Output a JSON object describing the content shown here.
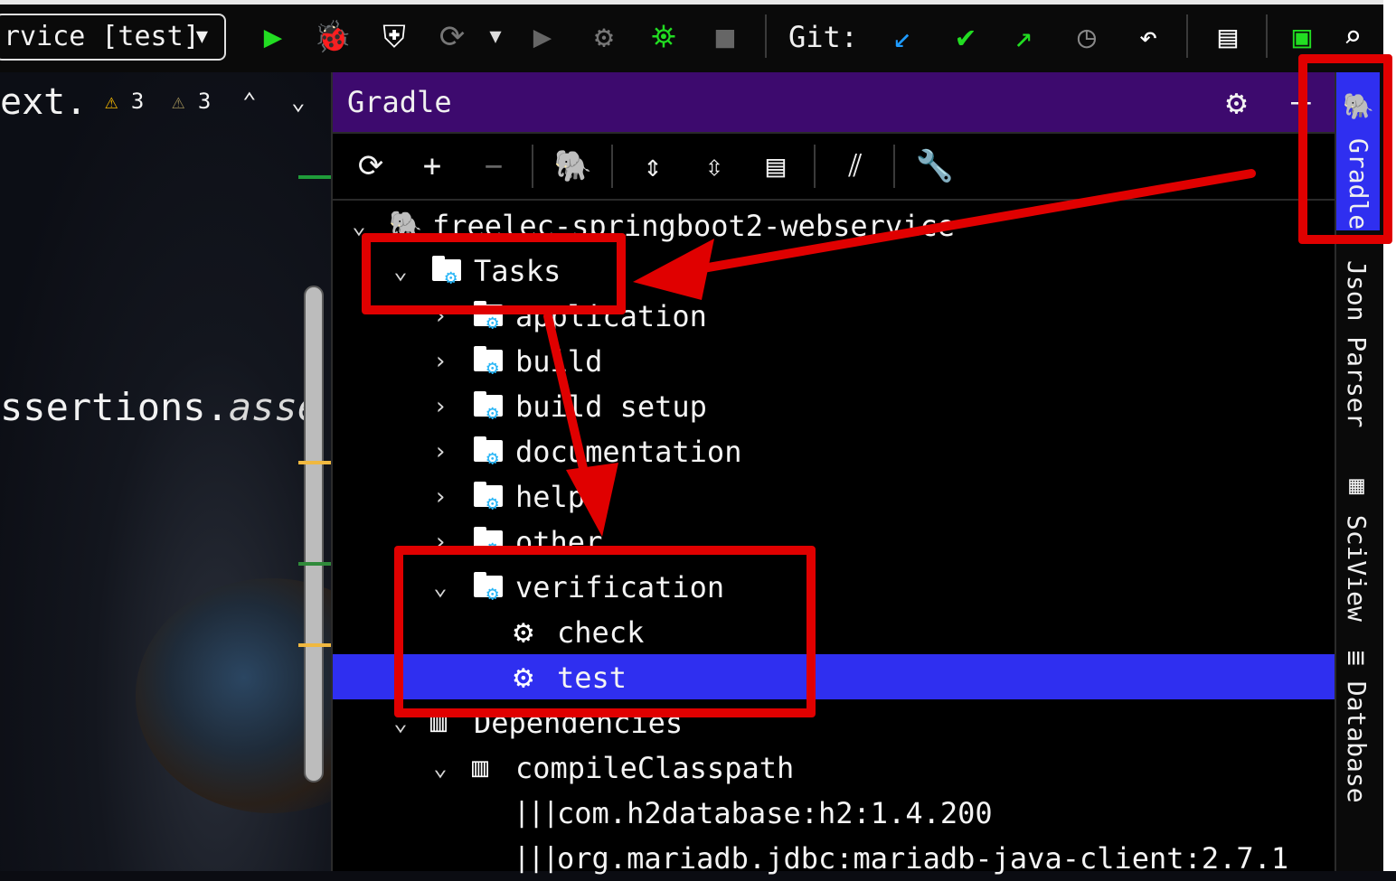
{
  "toolbar": {
    "run_config": "rvice [test]",
    "git_label": "Git:"
  },
  "editor": {
    "header_text": "ext.",
    "warning_count_1": "3",
    "warning_count_2": "3",
    "code_prefix": "ssertions.",
    "code_italic": "asse"
  },
  "gradle": {
    "title": "Gradle",
    "project": "freelec-springboot2-webservice",
    "tasks_label": "Tasks",
    "task_groups": [
      "application",
      "build",
      "build setup",
      "documentation",
      "help",
      "other"
    ],
    "verification_label": "verification",
    "verification_tasks": [
      "check",
      "test"
    ],
    "dependencies_label": "Dependencies",
    "compile_classpath_label": "compileClasspath",
    "deps": [
      "com.h2database:h2:1.4.200",
      "org.mariadb.jdbc:mariadb-java-client:2.7.1"
    ]
  },
  "right_strip": {
    "tabs": [
      "Gradle",
      "Json Parser",
      "SciView",
      "Database"
    ]
  },
  "colors": {
    "gradle_header": "#3d0a6e",
    "selection": "#2f2ff0",
    "annotation_red": "#e00000",
    "run_green": "#22dd22",
    "git_blue": "#1e9bff"
  }
}
